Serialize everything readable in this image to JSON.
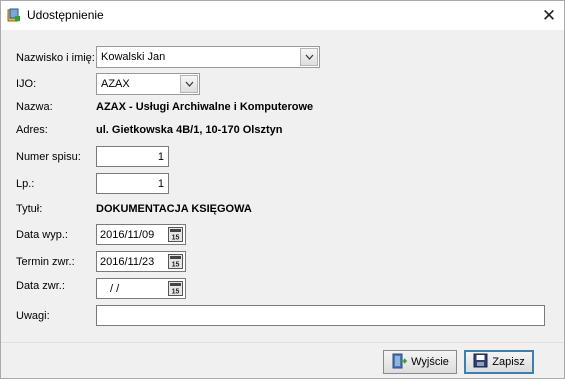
{
  "window": {
    "title": "Udostępnienie",
    "close_glyph": "✕"
  },
  "form": {
    "nazwisko": {
      "label": "Nazwisko i imię:",
      "value": "Kowalski Jan"
    },
    "ijo": {
      "label": "IJO:",
      "value": "AZAX"
    },
    "nazwa": {
      "label": "Nazwa:",
      "value": "AZAX - Usługi Archiwalne i Komputerowe"
    },
    "adres": {
      "label": "Adres:",
      "value": "ul. Gietkowska 4B/1, 10-170 Olsztyn"
    },
    "numer_spisu": {
      "label": "Numer spisu:",
      "value": "1"
    },
    "lp": {
      "label": "Lp.:",
      "value": "1"
    },
    "tytul": {
      "label": "Tytuł:",
      "value": "DOKUMENTACJA KSIĘGOWA"
    },
    "data_wyp": {
      "label": "Data wyp.:",
      "value": "2016/11/09"
    },
    "termin_zwr": {
      "label": "Termin zwr.:",
      "value": "2016/11/23"
    },
    "data_zwr": {
      "label": "Data zwr.:",
      "value": " / /"
    },
    "uwagi": {
      "label": "Uwagi:",
      "value": ""
    }
  },
  "buttons": {
    "exit": "Wyjście",
    "save": "Zapisz"
  },
  "icons": {
    "app": "app-icon",
    "close": "close-icon",
    "dropdown": "chevron-down-icon",
    "calendar": "calendar-icon",
    "exit": "exit-door-icon",
    "save": "floppy-disk-icon"
  },
  "colors": {
    "default_button_border": "#3c7fb1",
    "window_bg": "#f0f0f0"
  }
}
